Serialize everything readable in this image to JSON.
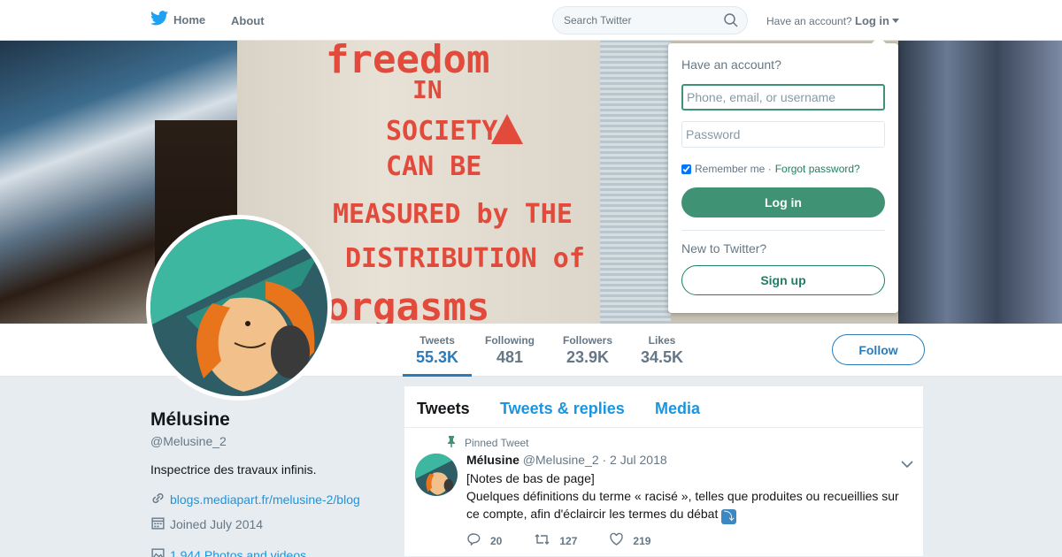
{
  "nav": {
    "home_label": "Home",
    "about_label": "About",
    "search_placeholder": "Search Twitter",
    "have_account": "Have an account?",
    "login_label": "Log in",
    "icons": {
      "logo": "twitter-bird-icon",
      "search": "search-icon",
      "caret": "caret-down-icon"
    },
    "colors": {
      "brand": "#1da1f2"
    }
  },
  "banner": {
    "poster_lines": [
      "freedom",
      "IN",
      "SOCIETY",
      "CAN BE",
      "MEASURED by THE",
      "DISTRIBUTION of",
      "orgasms"
    ]
  },
  "profile": {
    "name": "Mélusine",
    "handle": "@Melusine_2",
    "bio": "Inspectrice des travaux infinis.",
    "website": "blogs.mediapart.fr/melusine-2/blog",
    "joined": "Joined July 2014",
    "photos": "1,944 Photos and videos"
  },
  "stats": [
    {
      "label": "Tweets",
      "value": "55.3K",
      "active": true
    },
    {
      "label": "Following",
      "value": "481"
    },
    {
      "label": "Followers",
      "value": "23.9K"
    },
    {
      "label": "Likes",
      "value": "34.5K"
    }
  ],
  "follow_label": "Follow",
  "timeline": {
    "tabs": [
      "Tweets",
      "Tweets & replies",
      "Media"
    ],
    "pinned_label": "Pinned Tweet",
    "tweet": {
      "author": "Mélusine",
      "handle": "@Melusine_2",
      "date": "· 2 Jul 2018",
      "line1": "[Notes de bas de page]",
      "line2": "Quelques définitions du terme « racisé », telles que produites ou recueillies sur ce compte, afin d'éclaircir les termes du débat",
      "emoji": "⤵",
      "replies": "20",
      "retweets": "127",
      "likes": "219"
    }
  },
  "login_dropdown": {
    "title": "Have an account?",
    "username_placeholder": "Phone, email, or username",
    "password_placeholder": "Password",
    "remember_label": "Remember me ·",
    "forgot_label": "Forgot password?",
    "login_button": "Log in",
    "new_label": "New to Twitter?",
    "signup_button": "Sign up",
    "colors": {
      "accent": "#3f9274"
    }
  }
}
